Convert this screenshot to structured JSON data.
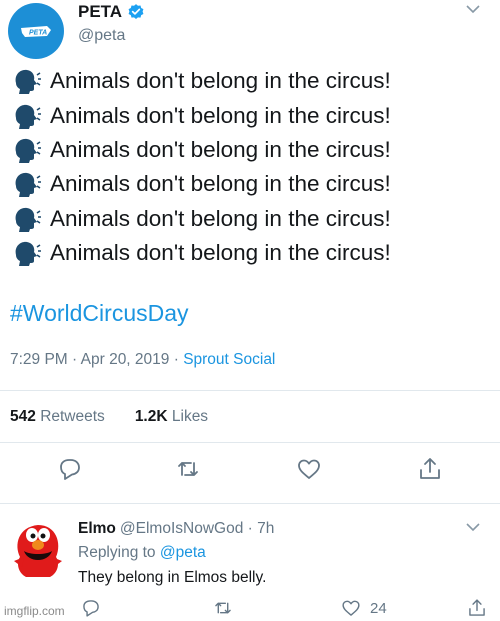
{
  "tweet": {
    "author_name": "PETA",
    "author_handle": "@peta",
    "lines": [
      "Animals don't belong in the circus!",
      "Animals don't belong in the circus!",
      "Animals don't belong in the circus!",
      "Animals don't belong in the circus!",
      "Animals don't belong in the circus!",
      "Animals don't belong in the circus!"
    ],
    "hashtag": "#WorldCircusDay",
    "time": "7:29 PM · Apr 20, 2019 ·",
    "source": "Sprout Social",
    "retweets_count": "542",
    "retweets_label": "Retweets",
    "likes_count": "1.2K",
    "likes_label": "Likes",
    "logo_text": "PETA"
  },
  "reply": {
    "author_name": "Elmo",
    "author_handle": "@ElmoIsNowGod · 7h",
    "replying_prefix": "Replying to",
    "replying_to": "@peta",
    "text": "They belong in Elmos belly.",
    "like_count": "24"
  },
  "watermark": "imgflip.com",
  "colors": {
    "link": "#1b95e0",
    "muted": "#657786",
    "text": "#14171a",
    "divider": "#e1e8ed",
    "peta_blue": "#1d8fd6",
    "elmo_red": "#e01b1b"
  },
  "icons": {
    "line_icon": "speaking-head-icon",
    "verified": "verified-badge-icon",
    "actions": [
      "reply-icon",
      "retweet-icon",
      "like-icon",
      "share-icon"
    ]
  }
}
